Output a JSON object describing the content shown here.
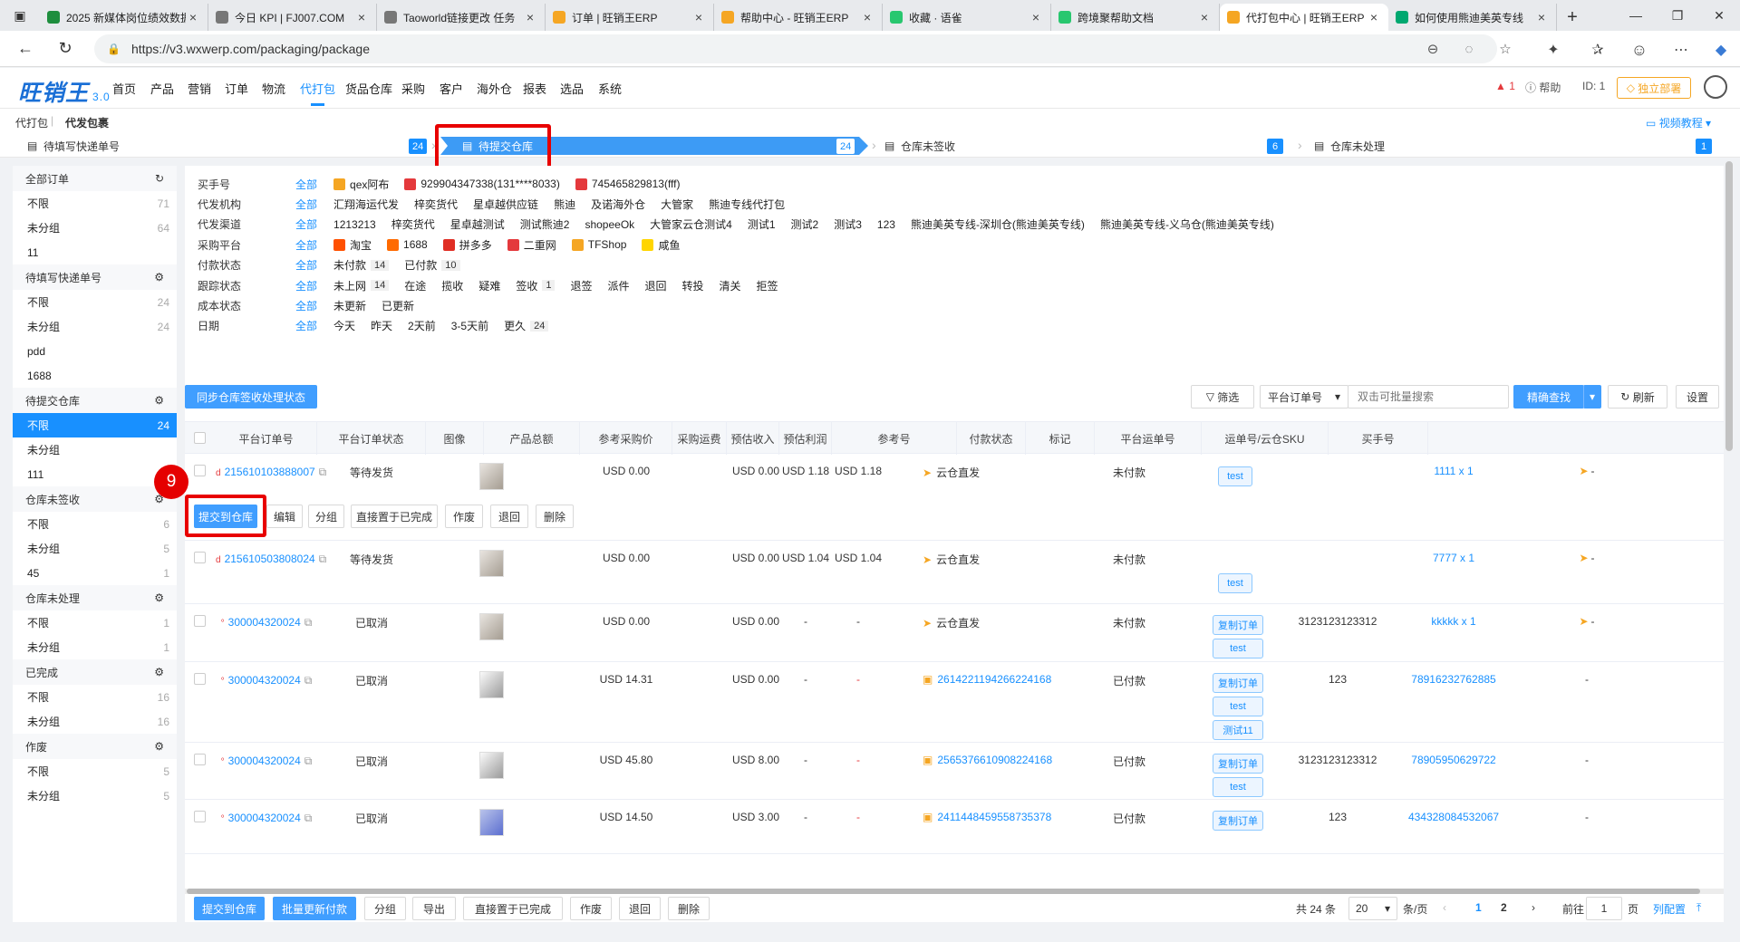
{
  "browser": {
    "tabs": [
      {
        "title": "2025 新媒体岗位绩效数据",
        "color": "#1e8e3e"
      },
      {
        "title": "今日 KPI | FJ007.COM",
        "color": "#777"
      },
      {
        "title": "Taoworld链接更改 任务",
        "color": "#777"
      },
      {
        "title": "订单 | 旺销王ERP",
        "color": "#f5a623"
      },
      {
        "title": "帮助中心 - 旺销王ERP",
        "color": "#f5a623"
      },
      {
        "title": "收藏 · 语雀",
        "color": "#28c76f"
      },
      {
        "title": "跨境聚帮助文档",
        "color": "#28c76f"
      },
      {
        "title": "代打包中心 | 旺销王ERP",
        "color": "#f5a623"
      },
      {
        "title": "如何使用熊迪美英专线",
        "color": "#00a870"
      }
    ],
    "url": "https://v3.wxwerp.com/packaging/package"
  },
  "app": {
    "logo": "旺销王",
    "version": "3.0",
    "menu": [
      "首页",
      "产品",
      "营销",
      "订单",
      "物流",
      "代打包",
      "货品仓库",
      "采购",
      "客户",
      "海外仓",
      "报表",
      "选品",
      "系统"
    ],
    "alert_count": "1",
    "help": "帮助",
    "id_label": "ID: 1",
    "deploy": "独立部署"
  },
  "breadcrumb": {
    "parent": "代打包",
    "current": "代发包裹",
    "video": "视频教程"
  },
  "steps": [
    {
      "label": "待填写快递单号",
      "count": "24"
    },
    {
      "label": "待提交仓库",
      "count": "24"
    },
    {
      "label": "仓库未签收",
      "count": "6"
    },
    {
      "label": "仓库未处理",
      "count": "1"
    }
  ],
  "sidebar": [
    {
      "title": "全部订单",
      "icon": "↻",
      "items": [
        {
          "label": "不限",
          "count": "71"
        },
        {
          "label": "未分组",
          "count": "64"
        },
        {
          "label": "11",
          "count": ""
        }
      ]
    },
    {
      "title": "待填写快递单号",
      "icon": "⚙",
      "items": [
        {
          "label": "不限",
          "count": "24"
        },
        {
          "label": "未分组",
          "count": "24"
        },
        {
          "label": "pdd",
          "count": ""
        },
        {
          "label": "1688",
          "count": ""
        }
      ]
    },
    {
      "title": "待提交仓库",
      "icon": "⚙",
      "items": [
        {
          "label": "不限",
          "count": "24"
        },
        {
          "label": "未分组",
          "count": ""
        },
        {
          "label": "111",
          "count": ""
        }
      ]
    },
    {
      "title": "仓库未签收",
      "icon": "⚙",
      "items": [
        {
          "label": "不限",
          "count": "6"
        },
        {
          "label": "未分组",
          "count": "5"
        },
        {
          "label": "45",
          "count": "1"
        }
      ]
    },
    {
      "title": "仓库未处理",
      "icon": "⚙",
      "items": [
        {
          "label": "不限",
          "count": "1"
        },
        {
          "label": "未分组",
          "count": "1"
        }
      ]
    },
    {
      "title": "已完成",
      "icon": "⚙",
      "items": [
        {
          "label": "不限",
          "count": "16"
        },
        {
          "label": "未分组",
          "count": "16"
        }
      ]
    },
    {
      "title": "作废",
      "icon": "⚙",
      "items": [
        {
          "label": "不限",
          "count": "5"
        },
        {
          "label": "未分组",
          "count": "5"
        }
      ]
    }
  ],
  "filters": [
    {
      "label": "买手号",
      "all": "全部",
      "options": [
        {
          "text": "qex阿布",
          "icon": "#f5a623"
        },
        {
          "text": "929904347338(131****8033)",
          "icon": "#e4393c"
        },
        {
          "text": "745465829813(fff)",
          "icon": "#e4393c"
        }
      ]
    },
    {
      "label": "代发机构",
      "all": "全部",
      "options": [
        {
          "text": "汇翔海运代发"
        },
        {
          "text": "梓奕货代"
        },
        {
          "text": "星卓越供应链"
        },
        {
          "text": "熊迪"
        },
        {
          "text": "及诺海外仓"
        },
        {
          "text": "大管家"
        },
        {
          "text": "熊迪专线代打包"
        }
      ]
    },
    {
      "label": "代发渠道",
      "all": "全部",
      "options": [
        {
          "text": "1213213"
        },
        {
          "text": "梓奕货代"
        },
        {
          "text": "星卓越测试"
        },
        {
          "text": "测试熊迪2"
        },
        {
          "text": "shopeeOk"
        },
        {
          "text": "大管家云仓测试4"
        },
        {
          "text": "测试1"
        },
        {
          "text": "测试2"
        },
        {
          "text": "测试3"
        },
        {
          "text": "123"
        },
        {
          "text": "熊迪美英专线-深圳仓(熊迪美英专线)"
        },
        {
          "text": "熊迪美英专线-义乌仓(熊迪美英专线)"
        }
      ]
    },
    {
      "label": "采购平台",
      "all": "全部",
      "options": [
        {
          "text": "淘宝",
          "icon": "#ff5000"
        },
        {
          "text": "1688",
          "icon": "#ff6a00"
        },
        {
          "text": "拼多多",
          "icon": "#e02e24"
        },
        {
          "text": "二重网",
          "icon": "#e4393c"
        },
        {
          "text": "TFShop",
          "icon": "#f5a623"
        },
        {
          "text": "咸鱼",
          "icon": "#ffd500"
        }
      ]
    },
    {
      "label": "付款状态",
      "all": "全部",
      "options": [
        {
          "text": "未付款",
          "num": "14"
        },
        {
          "text": "已付款",
          "num": "10"
        }
      ]
    },
    {
      "label": "跟踪状态",
      "all": "全部",
      "options": [
        {
          "text": "未上网",
          "num": "14"
        },
        {
          "text": "在途"
        },
        {
          "text": "揽收"
        },
        {
          "text": "疑难"
        },
        {
          "text": "签收",
          "num": "1"
        },
        {
          "text": "退签"
        },
        {
          "text": "派件"
        },
        {
          "text": "退回"
        },
        {
          "text": "转投"
        },
        {
          "text": "清关"
        },
        {
          "text": "拒签"
        }
      ]
    },
    {
      "label": "成本状态",
      "all": "全部",
      "options": [
        {
          "text": "未更新"
        },
        {
          "text": "已更新"
        }
      ]
    },
    {
      "label": "日期",
      "all": "全部",
      "options": [
        {
          "text": "今天"
        },
        {
          "text": "昨天"
        },
        {
          "text": "2天前"
        },
        {
          "text": "3-5天前"
        },
        {
          "text": "更久",
          "num": "24"
        }
      ]
    }
  ],
  "toolbar": {
    "sync": "同步仓库签收处理状态",
    "filter": "筛选",
    "search_type": "平台订单号",
    "search_placeholder": "双击可批量搜索",
    "exact": "精确查找",
    "refresh": "刷新",
    "settings": "设置"
  },
  "columns": [
    "平台订单号",
    "平台订单状态",
    "图像",
    "产品总额",
    "参考采购价",
    "采购运费",
    "预估收入",
    "预估利润",
    "参考号",
    "付款状态",
    "标记",
    "平台运单号",
    "运单号/云仓SKU",
    "买手号"
  ],
  "row_actions": [
    "提交到仓库",
    "编辑",
    "分组",
    "直接置于已完成",
    "作废",
    "退回",
    "删除"
  ],
  "step_marker": "9",
  "rows": [
    {
      "order": "215610103888007",
      "status": "等待发货",
      "total": "USD 0.00",
      "freight": "USD 0.00",
      "income": "USD 1.18",
      "profit": "USD 1.18",
      "ref": "云仓直发",
      "pay": "未付款",
      "tags": [
        "test"
      ],
      "tracking": "",
      "sku": "1111 x 1",
      "buyer": "-"
    },
    {
      "order": "215610503808024",
      "status": "等待发货",
      "total": "USD 0.00",
      "freight": "USD 0.00",
      "income": "USD 1.04",
      "profit": "USD 1.04",
      "ref": "云仓直发",
      "pay": "未付款",
      "tags": [
        "test"
      ],
      "tracking": "",
      "sku": "7777 x 1",
      "buyer": "-"
    },
    {
      "order": "300004320024",
      "status": "已取消",
      "total": "USD 0.00",
      "freight": "USD 0.00",
      "income": "-",
      "profit": "-",
      "ref": "云仓直发",
      "pay": "未付款",
      "tags": [
        "复制订单",
        "test"
      ],
      "tracking": "3123123123312",
      "sku": "kkkkk x 1",
      "buyer": "-"
    },
    {
      "order": "300004320024",
      "status": "已取消",
      "total": "USD 14.31",
      "freight": "USD 0.00",
      "income": "-",
      "profit": "-",
      "ref": "2614221194266224168",
      "pay": "已付款",
      "tags": [
        "复制订单",
        "test",
        "测试11"
      ],
      "tracking": "123",
      "sku": "78916232762885",
      "buyer": "-"
    },
    {
      "order": "300004320024",
      "status": "已取消",
      "total": "USD 45.80",
      "freight": "USD 8.00",
      "income": "-",
      "profit": "-",
      "ref": "2565376610908224168",
      "pay": "已付款",
      "tags": [
        "复制订单",
        "test"
      ],
      "tracking": "3123123123312",
      "sku": "78905950629722",
      "buyer": "-"
    },
    {
      "order": "300004320024",
      "status": "已取消",
      "total": "USD 14.50",
      "freight": "USD 3.00",
      "income": "-",
      "profit": "-",
      "ref": "2411448459558735378",
      "pay": "已付款",
      "tags": [
        "复制订单"
      ],
      "tracking": "123",
      "sku": "434328084532067",
      "buyer": "-"
    }
  ],
  "bottom": {
    "submit": "提交到仓库",
    "batch": "批量更新付款",
    "group": "分组",
    "export": "导出",
    "done": "直接置于已完成",
    "void": "作废",
    "back": "退回",
    "delete": "删除",
    "total": "共 24 条",
    "pagesize": "20",
    "per_page": "条/页",
    "pages": [
      "1",
      "2"
    ],
    "goto": "前往",
    "goto_val": "1",
    "page_unit": "页",
    "config": "列配置"
  }
}
